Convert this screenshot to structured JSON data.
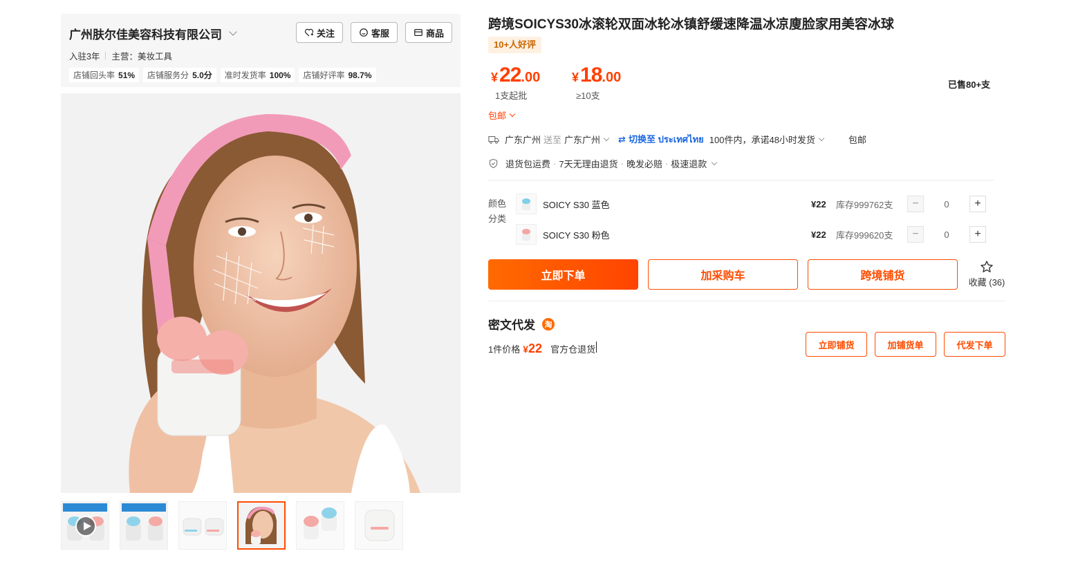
{
  "shop": {
    "name": "广州肤尔佳美容科技有限公司",
    "buttons": {
      "follow": "关注",
      "service": "客服",
      "products": "商品"
    },
    "years": "入驻3年",
    "main_category": "主营：美妆工具",
    "stats": [
      {
        "label": "店铺回头率",
        "value": "51%"
      },
      {
        "label": "店铺服务分",
        "value": "5.0分"
      },
      {
        "label": "准时发货率",
        "value": "100%"
      },
      {
        "label": "店铺好评率",
        "value": "98.7%"
      }
    ]
  },
  "product": {
    "title": "跨境SOICYS30冰滚轮双面冰轮冰镇舒缓速降温冰凉廋脸家用美容冰球",
    "praise_badge": "10+人好评",
    "prices": [
      {
        "currency": "¥",
        "integer": "22",
        "decimal": ".00",
        "condition": "1支起批"
      },
      {
        "currency": "¥",
        "integer": "18",
        "decimal": ".00",
        "condition": "≥10支"
      }
    ],
    "sold": "已售80+支",
    "free_shipping": "包邮"
  },
  "shipping": {
    "from": "广东广州",
    "to_word": "送至",
    "to": "广东广州",
    "switch_label": "切换至 ประเทศไทย",
    "promise": "100件内，承诺48小时发货",
    "free": "包邮"
  },
  "services": [
    "退货包运费",
    "7天无理由退货",
    "晚发必赔",
    "极速退款"
  ],
  "sku": {
    "label": "颜色分类",
    "options": [
      {
        "name": "SOICY S30 蓝色",
        "price": "¥22",
        "stock": "库存999762支",
        "qty": "0",
        "color": "#7fd0e8"
      },
      {
        "name": "SOICY S30 粉色",
        "price": "¥22",
        "stock": "库存999620支",
        "qty": "0",
        "color": "#f4a6a6"
      }
    ]
  },
  "actions": {
    "buy_now": "立即下单",
    "add_cart": "加采购车",
    "cross_border": "跨境铺货",
    "favorite": "收藏 (36)"
  },
  "miwen": {
    "title": "密文代发",
    "badge": "淘",
    "price_label": "1件价格",
    "price_currency": "¥",
    "price_value": "22",
    "note": "官方仓退货",
    "buttons": {
      "list_now": "立即铺货",
      "add_list": "加铺货单",
      "dropship": "代发下单"
    }
  },
  "colors": {
    "accent": "#ff4c00",
    "link_blue": "#1a66e0"
  }
}
